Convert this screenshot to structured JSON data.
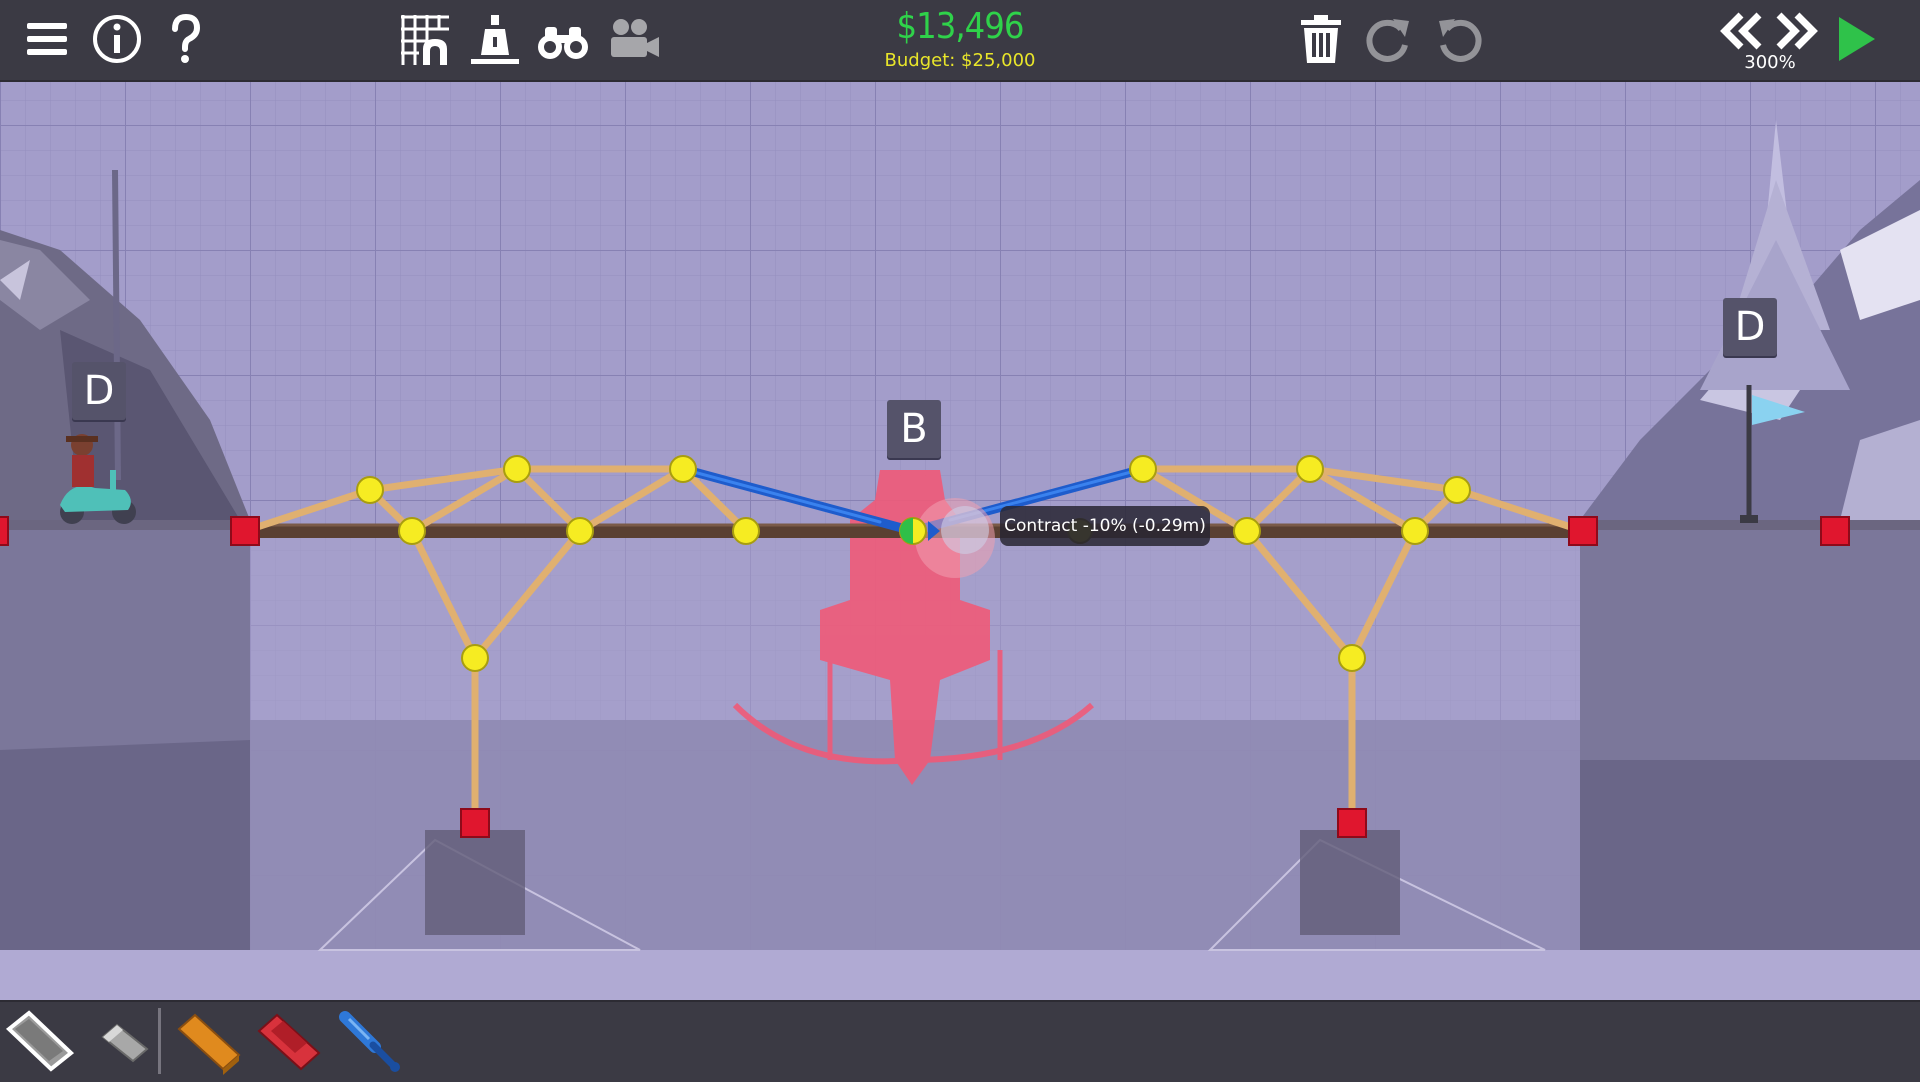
{
  "toolbar": {
    "left_icons": [
      "menu-icon",
      "info-icon",
      "help-icon"
    ],
    "center_left_icons": [
      "grid-toggle-icon",
      "load-weight-icon",
      "binoculars-icon",
      "camera-icon"
    ],
    "money_remaining": "$13,496",
    "budget_label": "Budget: $25,000",
    "right_icons": [
      "trash-icon",
      "redo-icon",
      "undo-icon"
    ],
    "speed_icons": [
      "rewind-icon",
      "fast-forward-icon",
      "play-icon"
    ],
    "sim_speed": "300%"
  },
  "bottom_bar": {
    "materials": [
      {
        "name": "road-material",
        "color": "#8a8a8a"
      },
      {
        "name": "eraser-tool",
        "color": "#9a9a9a"
      },
      {
        "name": "wood-material",
        "color": "#e08a1e"
      },
      {
        "name": "steel-material",
        "color": "#d8323c"
      },
      {
        "name": "hydraulic-material",
        "color": "#2e78d8"
      }
    ]
  },
  "scene": {
    "checkpoint_left": "D",
    "checkpoint_right": "D",
    "hydraulic_group": "B",
    "tooltip": "Contract -10% (-0.29m)",
    "colors": {
      "sky": "#9e98c6",
      "grid": "#8c86b8",
      "road": "#5a4032",
      "wood": "#e0b070",
      "hydraulic": "#1e5ccc",
      "joint": "#f6ec22",
      "anchor": "#e0162e",
      "helicopter": "#f05a78"
    }
  }
}
